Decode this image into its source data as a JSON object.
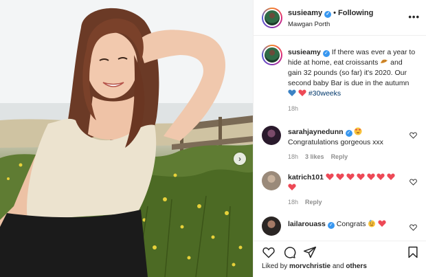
{
  "post": {
    "author": "susieamy",
    "follow_state": "Following",
    "separator": "•",
    "location": "Mawgan Porth",
    "more_label": "•••"
  },
  "caption": {
    "username": "susieamy",
    "text_part1": "If there was ever a year to hide at home, eat croissants",
    "text_part2": "and gain 32 pounds (so far) it's 2020. Our second baby Bar is due in the autumn",
    "hashtag": "#30weeks",
    "time": "18h"
  },
  "comments": [
    {
      "username": "sarahjaynedunn",
      "text": "Congratulations gorgeous xxx",
      "time": "18h",
      "likes": "3 likes",
      "reply": "Reply"
    },
    {
      "username": "katrich101",
      "text": "",
      "time": "18h",
      "reply": "Reply"
    },
    {
      "username": "lailarouass",
      "text": "Congrats",
      "time": "",
      "reply": ""
    }
  ],
  "likes_line": {
    "prefix": "Liked by",
    "user": "morvchristie",
    "joiner": "and",
    "others": "others"
  },
  "colors": {
    "verified": "#3897f0",
    "heart_red": "#ed4956",
    "heart_blue": "#3b82c4",
    "hashtag": "#00376b",
    "muted": "#8e8e8e"
  },
  "icons": [
    "heart-icon",
    "comment-icon",
    "share-icon",
    "bookmark-icon",
    "more-options-icon",
    "verified-badge-icon",
    "carousel-next-icon"
  ]
}
